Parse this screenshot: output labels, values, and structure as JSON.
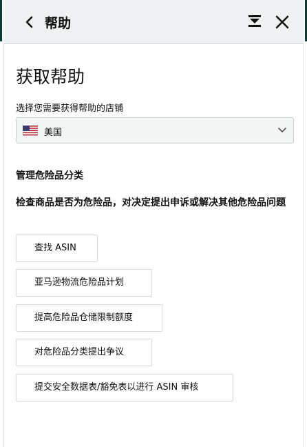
{
  "header": {
    "title": "帮助",
    "back_icon": "chevron-left-icon",
    "dock_icon": "dock-bottom-icon",
    "close_icon": "close-icon"
  },
  "panel": {
    "title": "获取帮助",
    "store_label": "选择您需要获得帮助的店铺",
    "store_select": {
      "flag_icon": "us-flag-icon",
      "value": "美国"
    },
    "section_title": "管理危险品分类",
    "section_description": "检查商品是否为危险品，对决定提出申诉或解决其他危险品问题",
    "options": [
      "查找 ASIN",
      "亚马逊物流危险品计划",
      "提高危险品仓储限制额度",
      "对危险品分类提出争议",
      "提交安全数据表/豁免表以进行 ASIN 审核"
    ]
  },
  "colors": {
    "header_bg": "#eef1f1",
    "edge_dark": "#0b3b33",
    "border": "#d5d9d9",
    "select_bg": "#f3f5f5"
  }
}
